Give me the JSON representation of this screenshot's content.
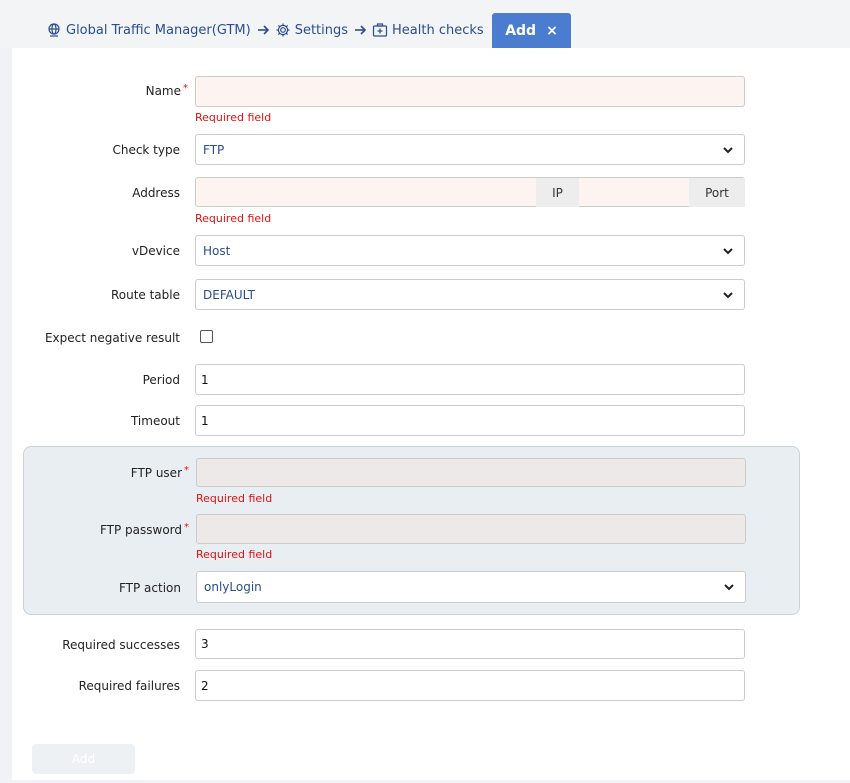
{
  "breadcrumb": {
    "items": [
      {
        "label": "Global Traffic Manager(GTM)",
        "icon": "globe-icon"
      },
      {
        "label": "Settings",
        "icon": "gear-icon"
      },
      {
        "label": "Health checks",
        "icon": "health-check-icon"
      }
    ]
  },
  "tab": {
    "label": "Add",
    "close": "×"
  },
  "form": {
    "name": {
      "label": "Name",
      "required": "*",
      "value": "",
      "error": "Required field"
    },
    "check_type": {
      "label": "Check type",
      "value": "FTP"
    },
    "address": {
      "label": "Address",
      "ip_addon": "IP",
      "port_addon": "Port",
      "error": "Required field"
    },
    "vdevice": {
      "label": "vDevice",
      "value": "Host"
    },
    "route_table": {
      "label": "Route table",
      "value": "DEFAULT"
    },
    "expect_negative": {
      "label": "Expect negative result",
      "checked": false
    },
    "period": {
      "label": "Period",
      "value": "1"
    },
    "timeout": {
      "label": "Timeout",
      "value": "1"
    },
    "ftp_user": {
      "label": "FTP user",
      "required": "*",
      "error": "Required field"
    },
    "ftp_password": {
      "label": "FTP password",
      "required": "*",
      "error": "Required field"
    },
    "ftp_action": {
      "label": "FTP action",
      "value": "onlyLogin"
    },
    "required_successes": {
      "label": "Required successes",
      "value": "3"
    },
    "required_failures": {
      "label": "Required failures",
      "value": "2"
    }
  },
  "footer": {
    "add_label": "Add"
  },
  "colors": {
    "accent": "#4a7cd0",
    "error": "#dd1111",
    "link": "#2a4d8f"
  }
}
